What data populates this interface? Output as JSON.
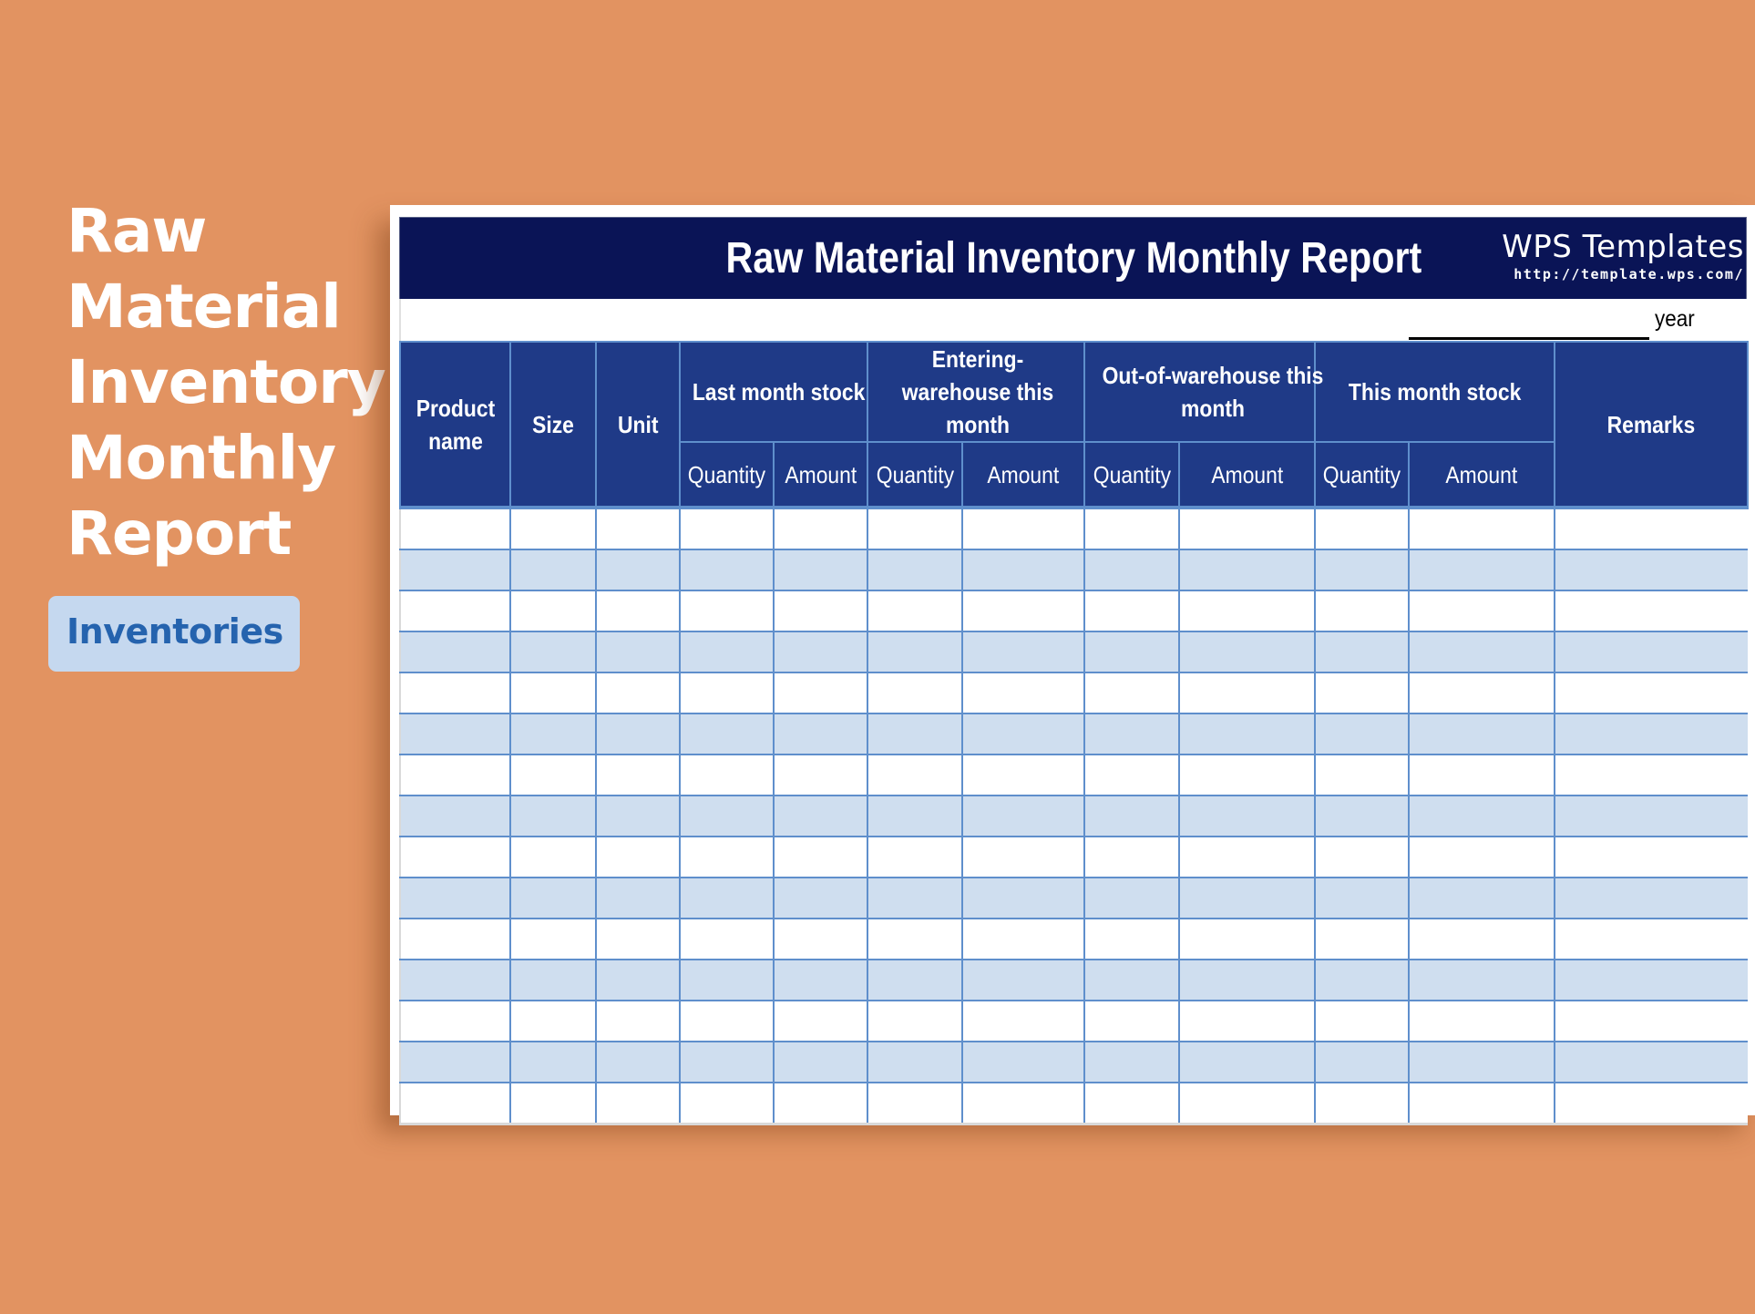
{
  "promo": {
    "title_lines": [
      "Raw",
      "Material",
      "Inventory",
      "Monthly",
      "Report"
    ],
    "badge": "Inventories"
  },
  "sheet": {
    "title": "Raw Material Inventory Monthly Report",
    "brand_name": "WPS Templates",
    "brand_url": "http://template.wps.com/",
    "year_label": "year",
    "year_value": ""
  },
  "table": {
    "headers": {
      "product_name": "Product name",
      "size": "Size",
      "unit": "Unit",
      "groups": [
        {
          "label": "Last month stock",
          "quantity": "Quantity",
          "amount": "Amount"
        },
        {
          "label": "Entering-warehouse this month",
          "quantity": "Quantity",
          "amount": "Amount"
        },
        {
          "label": "Out-of-warehouse this month",
          "quantity": "Quantity",
          "amount": "Amount"
        },
        {
          "label": "This month stock",
          "quantity": "Quantity",
          "amount": "Amount"
        }
      ],
      "remarks": "Remarks"
    },
    "row_count": 15,
    "rows": []
  },
  "colors": {
    "background": "#e29361",
    "title_bar": "#0a1456",
    "header": "#1f3a87",
    "grid_line": "#5f8fcc",
    "stripe": "#cfdeef",
    "badge_bg": "#c5d8ef",
    "badge_text": "#2563ae"
  }
}
